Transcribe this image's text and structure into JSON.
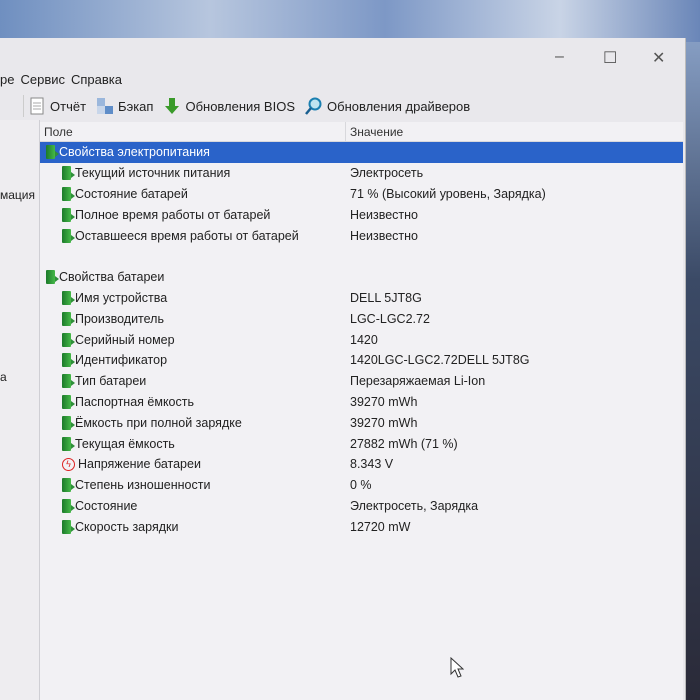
{
  "window": {
    "menu": [
      "ре",
      "Сервис",
      "Справка"
    ],
    "controls": {
      "minimize": "–",
      "maximize": "☐",
      "close": "✕"
    }
  },
  "toolbar": {
    "report": "Отчёт",
    "backup": "Бэкап",
    "bios": "Обновления BIOS",
    "drivers": "Обновления драйверов"
  },
  "left_panel": {
    "items": [
      "мация",
      "а"
    ]
  },
  "columns": {
    "field": "Поле",
    "value": "Значение"
  },
  "groups": [
    {
      "title": "Свойства электропитания",
      "selected": true,
      "rows": [
        {
          "field": "Текущий источник питания",
          "value": "Электросеть",
          "icon": "battery"
        },
        {
          "field": "Состояние батарей",
          "value": "71 % (Высокий уровень, Зарядка)",
          "icon": "battery"
        },
        {
          "field": "Полное время работы от батарей",
          "value": "Неизвестно",
          "icon": "battery"
        },
        {
          "field": "Оставшееся время работы от батарей",
          "value": "Неизвестно",
          "icon": "battery"
        }
      ]
    },
    {
      "title": "Свойства батареи",
      "selected": false,
      "rows": [
        {
          "field": "Имя устройства",
          "value": "DELL 5JT8G",
          "icon": "battery"
        },
        {
          "field": "Производитель",
          "value": "LGC-LGC2.72",
          "icon": "battery"
        },
        {
          "field": "Серийный номер",
          "value": "1420",
          "icon": "battery"
        },
        {
          "field": "Идентификатор",
          "value": "1420LGC-LGC2.72DELL 5JT8G",
          "icon": "battery"
        },
        {
          "field": "Тип батареи",
          "value": "Перезаряжаемая Li-Ion",
          "icon": "battery"
        },
        {
          "field": "Паспортная ёмкость",
          "value": "39270 mWh",
          "icon": "battery"
        },
        {
          "field": "Ёмкость при полной зарядке",
          "value": "39270 mWh",
          "icon": "battery"
        },
        {
          "field": "Текущая ёмкость",
          "value": "27882 mWh  (71 %)",
          "icon": "battery"
        },
        {
          "field": "Напряжение батареи",
          "value": "8.343 V",
          "icon": "voltage"
        },
        {
          "field": "Степень изношенности",
          "value": "0 %",
          "icon": "battery"
        },
        {
          "field": "Состояние",
          "value": "Электросеть, Зарядка",
          "icon": "battery"
        },
        {
          "field": "Скорость зарядки",
          "value": "12720 mW",
          "icon": "battery"
        }
      ]
    }
  ]
}
